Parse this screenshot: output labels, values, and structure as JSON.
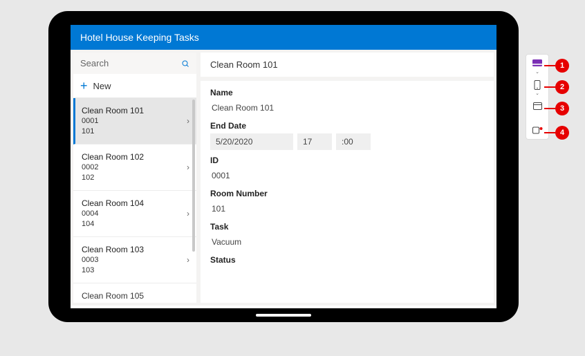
{
  "header": {
    "title": "Hotel House Keeping Tasks"
  },
  "sidebar": {
    "search_placeholder": "Search",
    "new_label": "New",
    "items": [
      {
        "title": "Clean Room 101",
        "id": "0001",
        "room": "101",
        "selected": true
      },
      {
        "title": "Clean Room 102",
        "id": "0002",
        "room": "102",
        "selected": false
      },
      {
        "title": "Clean Room 104",
        "id": "0004",
        "room": "104",
        "selected": false
      },
      {
        "title": "Clean Room 103",
        "id": "0003",
        "room": "103",
        "selected": false
      },
      {
        "title": "Clean Room 105",
        "id": "",
        "room": "",
        "selected": false
      }
    ]
  },
  "detail": {
    "header_title": "Clean Room 101",
    "labels": {
      "name": "Name",
      "end_date": "End Date",
      "id": "ID",
      "room_number": "Room Number",
      "task": "Task",
      "status": "Status"
    },
    "values": {
      "name": "Clean Room 101",
      "end_date_date": "5/20/2020",
      "end_date_hour": "17",
      "end_date_min": ":00",
      "id": "0001",
      "room_number": "101",
      "task": "Vacuum"
    }
  },
  "toolbar": {
    "items": [
      {
        "callout": "1",
        "icon": "card",
        "has_chevron": true
      },
      {
        "callout": "2",
        "icon": "phone",
        "has_chevron": true
      },
      {
        "callout": "3",
        "icon": "window",
        "has_chevron": false
      },
      {
        "callout": "4",
        "icon": "record",
        "has_chevron": false
      }
    ]
  }
}
